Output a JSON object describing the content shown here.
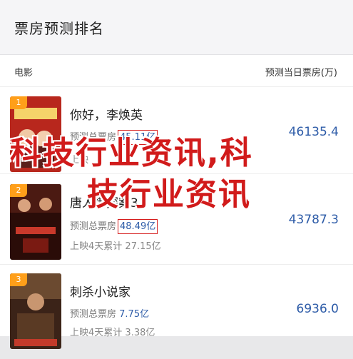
{
  "header": {
    "title": "票房预测排名"
  },
  "columns": {
    "left": "电影",
    "right": "预测当日票房(万)"
  },
  "rows": [
    {
      "rank": "1",
      "title": "你好，李焕英",
      "predict_label": "预测总票房",
      "predict_value": "45.11亿",
      "cume_label": "上映",
      "cume_value": "",
      "right_value": "46135.4"
    },
    {
      "rank": "2",
      "title": "唐人街探案3",
      "predict_label": "预测总票房",
      "predict_value": "48.49亿",
      "cume_label": "上映4天累计",
      "cume_value": "27.15亿",
      "right_value": "43787.3"
    },
    {
      "rank": "3",
      "title": "刺杀小说家",
      "predict_label": "预测总票房",
      "predict_value": "7.75亿",
      "cume_label": "上映4天累计",
      "cume_value": "3.38亿",
      "right_value": "6936.0"
    }
  ],
  "watermark": {
    "line1": "科技行业资讯,科",
    "line2": "技行业资讯"
  },
  "colors": {
    "accent": "#2e5ca8",
    "badge": "#ff9f1a",
    "mark": "#d61c1c"
  }
}
